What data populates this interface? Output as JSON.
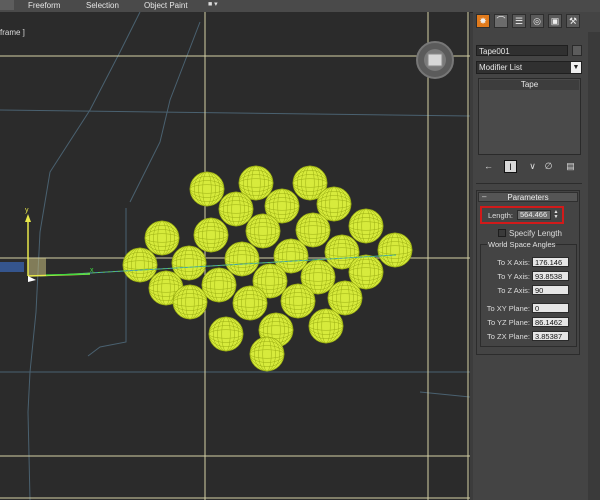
{
  "ribbon": {
    "tabs": [
      {
        "label": "Freeform"
      },
      {
        "label": "Selection"
      },
      {
        "label": "Object Paint"
      }
    ],
    "view_dropdown_label": "■ ▾"
  },
  "viewport": {
    "label": "frame ]"
  },
  "command_panel": {
    "tab_icons": [
      {
        "icon": "sun-icon",
        "glyph": "✸"
      },
      {
        "icon": "modify-curve-icon",
        "glyph": "⌒"
      },
      {
        "icon": "hierarchy-icon",
        "glyph": "☰"
      },
      {
        "icon": "motion-icon",
        "glyph": "◎"
      },
      {
        "icon": "display-icon",
        "glyph": "▣"
      },
      {
        "icon": "utilities-hammer-icon",
        "glyph": "⚒"
      }
    ],
    "object_name": "Tape001",
    "modifier_list_label": "Modifier List",
    "modifier_stack": [
      "Tape"
    ],
    "stack_tools": [
      {
        "icon": "pin-stack-icon",
        "glyph": "←"
      },
      {
        "icon": "show-end-result-icon",
        "glyph": "I"
      },
      {
        "icon": "make-unique-icon",
        "glyph": "∨"
      },
      {
        "icon": "remove-modifier-icon",
        "glyph": "∅"
      },
      {
        "icon": "configure-modifier-sets-icon",
        "glyph": "▤"
      }
    ]
  },
  "parameters": {
    "title": "Parameters",
    "length_label": "Length:",
    "length_value": "564.466",
    "specify_length_label": "Specify Length",
    "specify_length_checked": false,
    "world_space_title": "World Space Angles",
    "axes": [
      {
        "label": "To X Axis:",
        "value": "176.146"
      },
      {
        "label": "To Y Axis:",
        "value": "93.8538"
      },
      {
        "label": "To Z Axis:",
        "value": "90"
      }
    ],
    "planes": [
      {
        "label": "To XY Plane:",
        "value": "0"
      },
      {
        "label": "To YZ Plane:",
        "value": "86.1462"
      },
      {
        "label": "To ZX Plane:",
        "value": "3.85387"
      }
    ]
  },
  "gizmo": {
    "axis_y_label": "y",
    "axis_x_label": "x"
  },
  "colors": {
    "spheres": "#d7eb3c",
    "sphere_lines": "#9aae12",
    "highlight": "#d11a1a",
    "grid_lines": "#d4d0a6",
    "gizmo_x": "#3fdc3f",
    "gizmo_y": "#e8e84a"
  }
}
